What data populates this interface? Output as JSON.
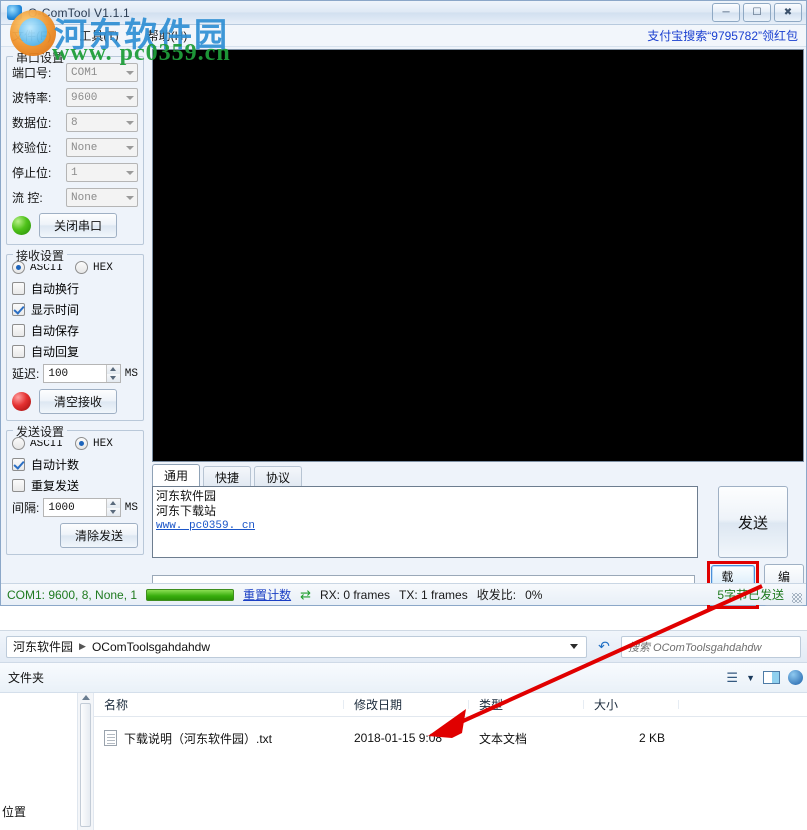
{
  "app": {
    "title": "O-ComTool V1.1.1",
    "icon": "app-icon",
    "window_buttons": [
      "minimize",
      "maximize",
      "close"
    ],
    "menus": [
      "文件(F)",
      "工具(T)",
      "帮助(H)"
    ],
    "ad_text": "支付宝搜索“9795782”领红包"
  },
  "serial_settings": {
    "group_title": "串口设置",
    "fields": [
      {
        "label": "端口号:",
        "value": "COM1"
      },
      {
        "label": "波特率:",
        "value": "9600"
      },
      {
        "label": "数据位:",
        "value": "8"
      },
      {
        "label": "校验位:",
        "value": "None"
      },
      {
        "label": "停止位:",
        "value": "1"
      },
      {
        "label": "流  控:",
        "value": "None"
      }
    ],
    "led": "green",
    "button": "关闭串口"
  },
  "receive_settings": {
    "group_title": "接收设置",
    "format": {
      "ascii": "ASCII",
      "hex": "HEX",
      "selected": "ASCII"
    },
    "checks": [
      {
        "label": "自动换行",
        "checked": false
      },
      {
        "label": "显示时间",
        "checked": true
      },
      {
        "label": "自动保存",
        "checked": false
      },
      {
        "label": "自动回复",
        "checked": false
      }
    ],
    "delay": {
      "label": "延迟:",
      "value": "100",
      "unit": "MS"
    },
    "led": "red",
    "button": "清空接收"
  },
  "send_settings": {
    "group_title": "发送设置",
    "format": {
      "ascii": "ASCII",
      "hex": "HEX",
      "selected": "HEX"
    },
    "checks": [
      {
        "label": "自动计数",
        "checked": true
      },
      {
        "label": "重复发送",
        "checked": false
      }
    ],
    "interval": {
      "label": "间隔:",
      "value": "1000",
      "unit": "MS"
    },
    "button": "清除发送"
  },
  "main": {
    "receive_display": "",
    "tabs": [
      {
        "label": "通用",
        "active": true
      },
      {
        "label": "快捷",
        "active": false
      },
      {
        "label": "协议",
        "active": false
      }
    ],
    "send_text_lines": [
      "河东软件园",
      "河东下载站"
    ],
    "send_text_link": "www. pc0359. cn",
    "send_button": "发送",
    "file_combo_value": "",
    "load_button": "载入",
    "edit_button": "编辑"
  },
  "statusbar": {
    "port_info": "COM1: 9600, 8, None, 1",
    "reset_count": "重置计数",
    "refresh_icon": "refresh-icon",
    "rx": "RX: 0 frames",
    "tx": "TX: 1 frames",
    "ratio_label": "收发比:",
    "ratio_value": "0%",
    "bytes_sent": "5字节已发送"
  },
  "explorer": {
    "breadcrumb": {
      "root": "河东软件园",
      "folder": "OComToolsgahdahdw"
    },
    "refresh_icon": "refresh-icon",
    "search_placeholder": "搜索 OComToolsgahdahdw",
    "toolbar_label": "文件夹",
    "toolbar_icons": [
      "view-list-icon",
      "chevron-down-icon",
      "preview-pane-icon",
      "help-icon"
    ],
    "nav_label": "位置",
    "columns": [
      "名称",
      "修改日期",
      "类型",
      "大小"
    ],
    "rows": [
      {
        "icon": "text-file-icon",
        "name": "下载说明（河东软件园）.txt",
        "date": "2018-01-15 9:08",
        "type": "文本文档",
        "size": "2 KB"
      }
    ]
  },
  "watermark": {
    "line1": "河东软件园",
    "line2": "www. pc0359.cn",
    "logo": "site-logo"
  },
  "colors": {
    "accent_blue": "#1a3fd0",
    "status_green": "#1f7a1f",
    "highlight_red": "#e00000",
    "link_blue": "#1a55c8"
  }
}
